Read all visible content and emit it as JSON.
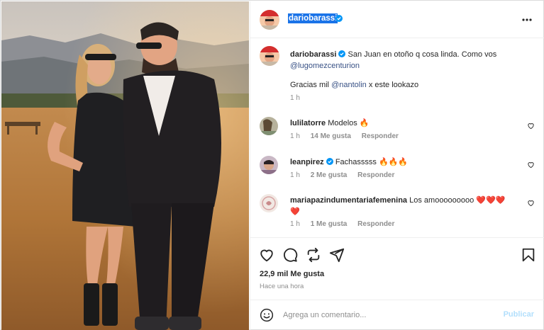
{
  "post": {
    "author": "dariobarassi",
    "caption_text": "San Juan en otoño q cosa linda. Como vos",
    "caption_mention": "@lugomezcenturion",
    "caption_line2_prefix": "Gracias mil ",
    "caption_line2_mention": "@nantolin",
    "caption_line2_suffix": " x este lookazo",
    "caption_time": "1 h"
  },
  "comments": [
    {
      "user": "lulilatorre",
      "verified": false,
      "text": "Modelos 🔥",
      "time": "1 h",
      "likes": "14 Me gusta",
      "reply": "Responder"
    },
    {
      "user": "leanpirez",
      "verified": true,
      "text": "Fachasssss 🔥🔥🔥",
      "time": "1 h",
      "likes": "2 Me gusta",
      "reply": "Responder"
    },
    {
      "user": "mariapazindumentariafemenina",
      "verified": false,
      "text": "Los amooooooooo ❤️❤️❤️",
      "text2": "❤️",
      "time": "1 h",
      "likes": "1 Me gusta",
      "reply": "Responder"
    }
  ],
  "footer": {
    "likes_count": "22,9 mil Me gusta",
    "posted_ago": "Hace una hora",
    "comment_placeholder": "Agrega un comentario...",
    "publish_label": "Publicar"
  },
  "colors": {
    "verified": "#0095f6",
    "mention": "#385185",
    "publish_disabled": "#b2dffc",
    "heart": "#ed4956"
  }
}
